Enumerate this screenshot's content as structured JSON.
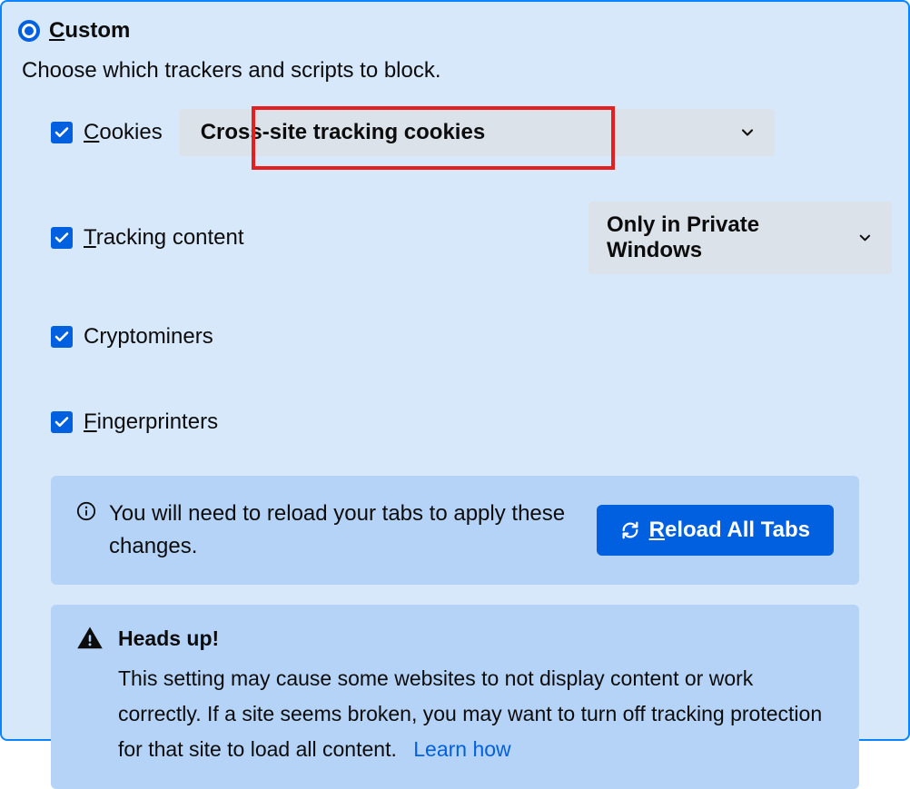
{
  "header": {
    "label_prefix": "C",
    "label_rest": "ustom"
  },
  "description": "Choose which trackers and scripts to block.",
  "options": {
    "cookies": {
      "prefix": "C",
      "rest": "ookies",
      "checked": true,
      "dropdown": "Cross-site tracking cookies"
    },
    "tracking": {
      "prefix": "T",
      "rest": "racking content",
      "checked": true,
      "dropdown": "Only in Private Windows"
    },
    "cryptominers": {
      "label": "Cryptominers",
      "checked": true
    },
    "fingerprinters": {
      "prefix": "F",
      "rest": "ingerprinters",
      "checked": true
    }
  },
  "info": {
    "message": "You will need to reload your tabs to apply these changes.",
    "button_prefix": "R",
    "button_rest": "eload All Tabs"
  },
  "warning": {
    "title": "Heads up!",
    "message": "This setting may cause some websites to not display content or work correctly. If a site seems broken, you may want to turn off tracking protection for that site to load all content.",
    "link": "Learn how"
  },
  "colors": {
    "accent": "#0060df",
    "panel_bg": "#d6e8fa",
    "box_bg": "#b4d3f6",
    "highlight": "#e61e1e"
  }
}
